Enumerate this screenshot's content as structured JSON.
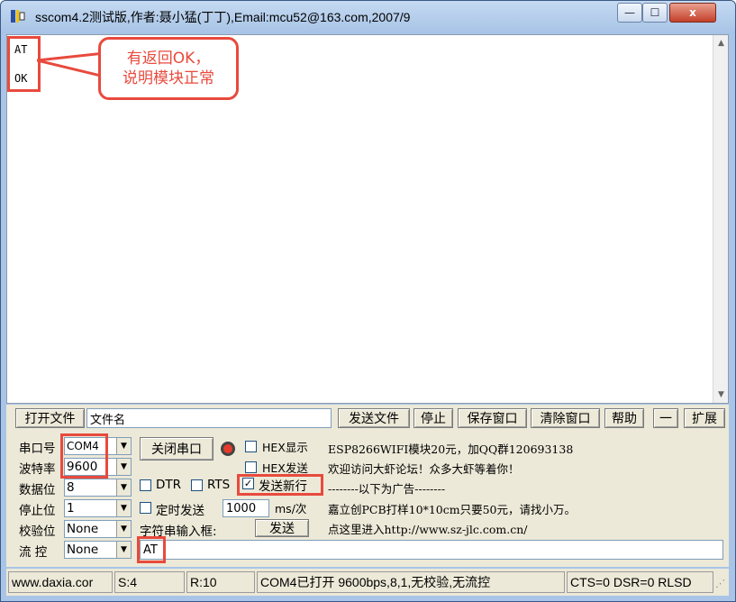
{
  "window": {
    "title": "sscom4.2测试版,作者:聂小猛(丁丁),Email:mcu52@163.com,2007/9",
    "close_label": "x",
    "min_label": "—",
    "max_label": "☐"
  },
  "receive": {
    "lines": [
      "AT",
      "OK"
    ]
  },
  "annotation": {
    "line1": "有返回OK，",
    "line2": "说明模块正常"
  },
  "file_row": {
    "open_file": "打开文件",
    "filename": "文件名",
    "send_file": "发送文件",
    "stop": "停止",
    "save_window": "保存窗口",
    "clear_window": "清除窗口",
    "help": "帮助",
    "dash": "一",
    "expand": "扩展"
  },
  "serial": {
    "port_label": "串口号",
    "port_value": "COM4",
    "baud_label": "波特率",
    "baud_value": "9600",
    "data_label": "数据位",
    "data_value": "8",
    "stop_label": "停止位",
    "stop_value": "1",
    "parity_label": "校验位",
    "parity_value": "None",
    "flow_label": "流 控",
    "flow_value": "None",
    "close_port": "关闭串口"
  },
  "options": {
    "hex_display": "HEX显示",
    "hex_send": "HEX发送",
    "dtr": "DTR",
    "rts": "RTS",
    "send_newline": "发送新行",
    "timed_send": "定时发送",
    "interval": "1000",
    "interval_unit": "ms/次",
    "input_label": "字符串输入框:",
    "send": "发送",
    "input_value": "AT"
  },
  "ads": {
    "line1": "ESP8266WIFI模块20元，加QQ群120693138",
    "line2": "欢迎访问大虾论坛！众多大虾等着你！",
    "line3": "--------以下为广告--------",
    "line4": "嘉立创PCB打样10*10cm只要50元，请找小万。",
    "line5": "点这里进入http://www.sz-jlc.com.cn/"
  },
  "status": {
    "site": "www.daxia.cor",
    "sent": "S:4",
    "received": "R:10",
    "port_state": "COM4已打开  9600bps,8,1,无校验,无流控",
    "signals": "CTS=0 DSR=0 RLSD"
  },
  "colors": {
    "annotation": "#e84a3d",
    "frame": "#a9c4e6",
    "panel": "#ece9d8"
  }
}
